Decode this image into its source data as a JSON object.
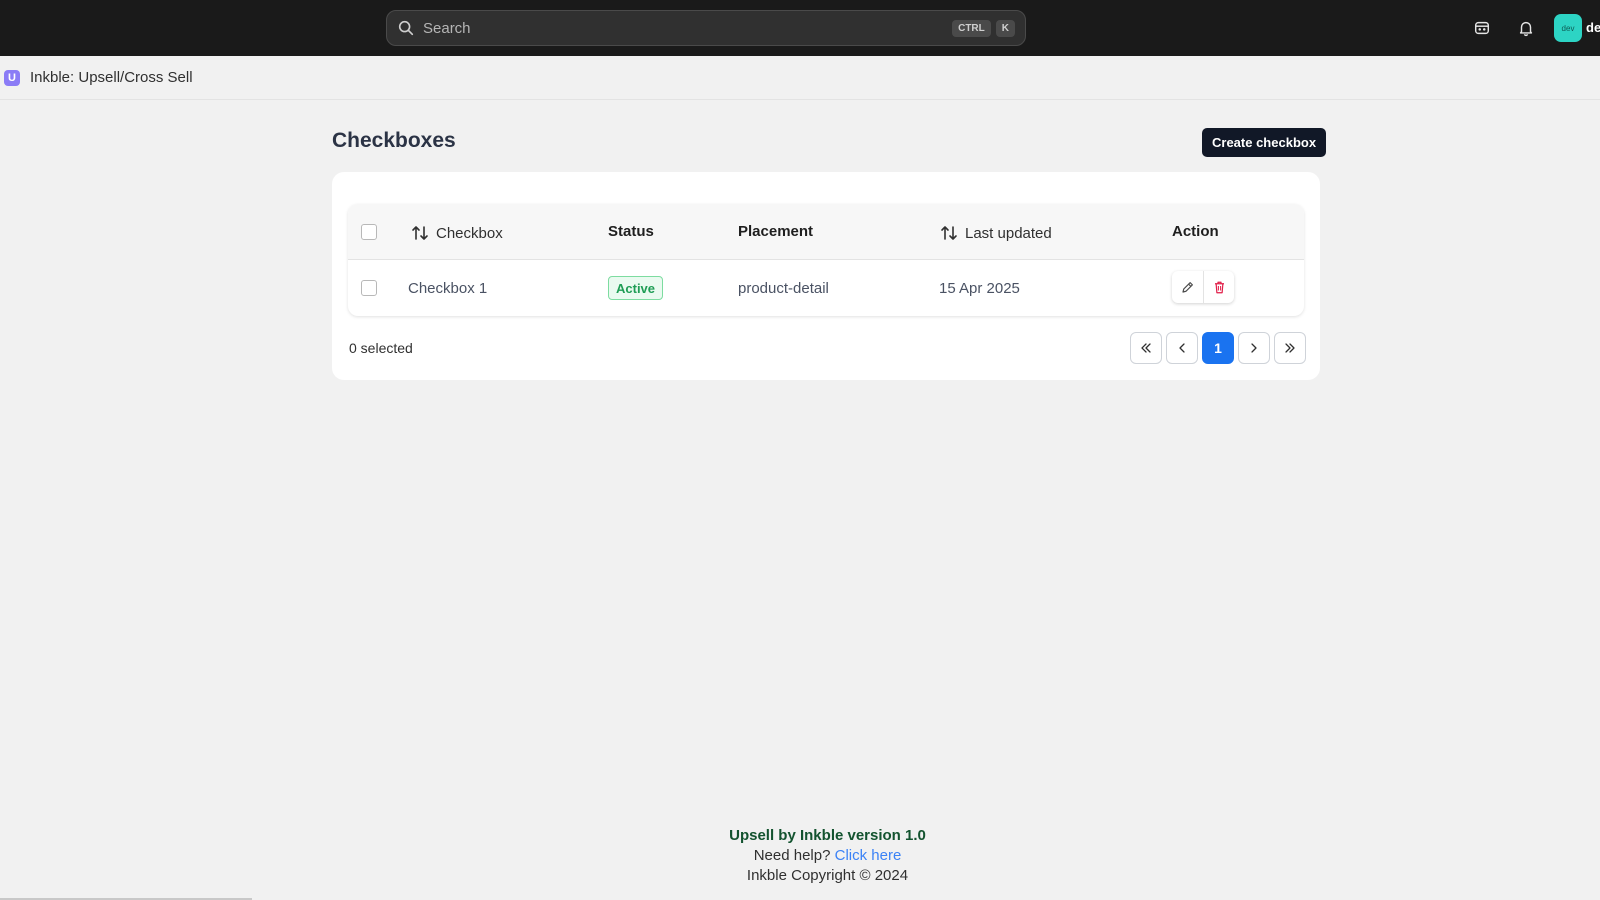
{
  "topbar": {
    "search_placeholder": "Search",
    "shortcut_key1": "CTRL",
    "shortcut_key2": "K",
    "avatar_initials": "dev",
    "username": "de"
  },
  "appbar": {
    "logo_letter": "U",
    "title": "Inkble: Upsell/Cross Sell"
  },
  "page": {
    "title": "Checkboxes",
    "create_label": "Create checkbox"
  },
  "table": {
    "columns": {
      "checkbox": "Checkbox",
      "status": "Status",
      "placement": "Placement",
      "last_updated": "Last updated",
      "action": "Action"
    },
    "rows": [
      {
        "name": "Checkbox 1",
        "status": "Active",
        "placement": "product-detail",
        "last_updated": "15 Apr 2025"
      }
    ]
  },
  "selection": {
    "text": "0 selected"
  },
  "pagination": {
    "current_page": "1"
  },
  "footer": {
    "brand": "Upsell by Inkble version 1.0",
    "help_text": "Need help?",
    "help_link": "Click here",
    "copyright": "Inkble Copyright © 2024"
  },
  "colors": {
    "topbar": "#1a1a1a",
    "primary_button": "#111827",
    "active_page": "#1a73f0",
    "status_active": "#1f9d55",
    "delete": "#e11d48"
  }
}
